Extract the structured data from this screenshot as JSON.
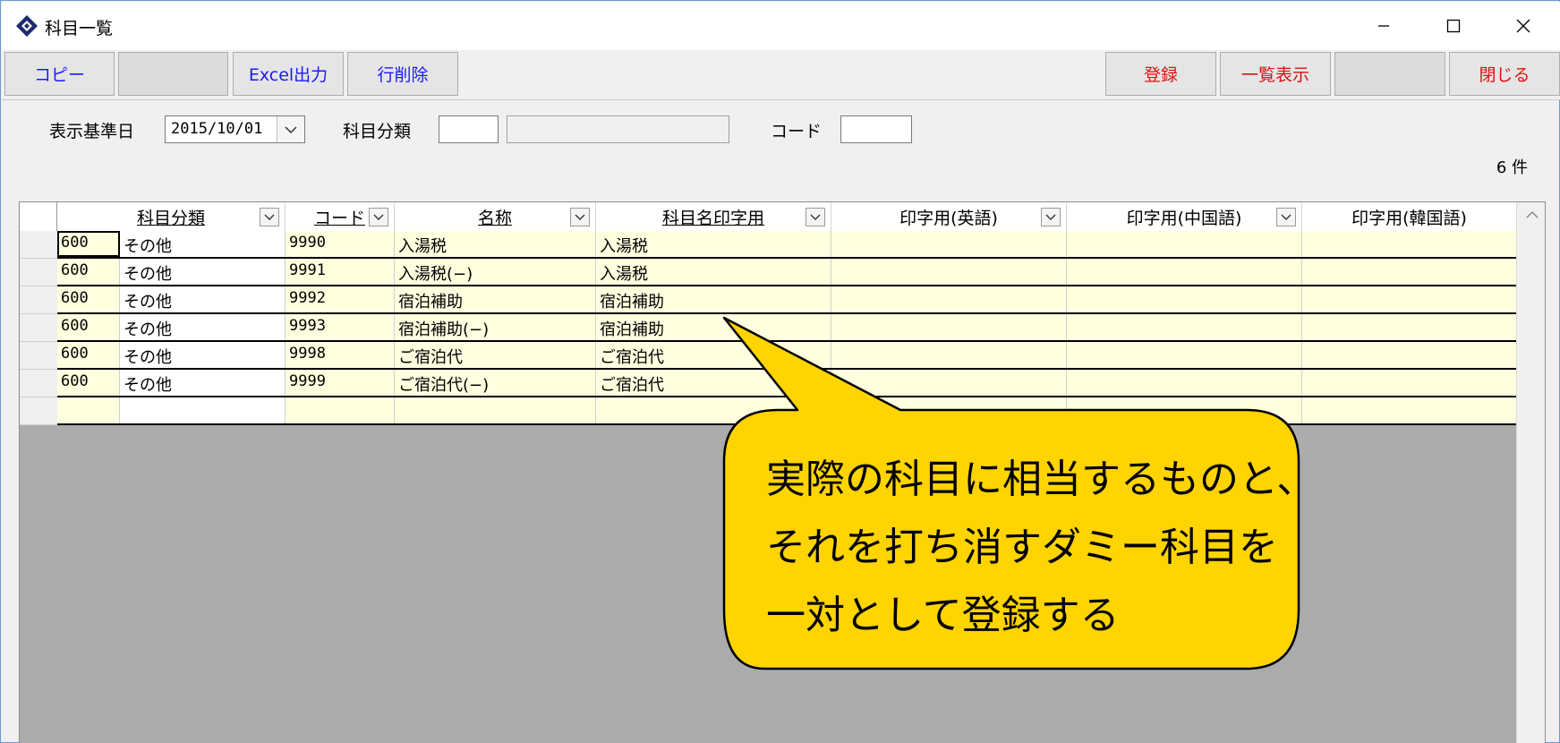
{
  "window": {
    "title": "科目一覧",
    "minimize_icon": "minimize-icon",
    "maximize_icon": "maximize-icon",
    "close_icon": "close-icon"
  },
  "toolbar": {
    "copy_label": "コピー",
    "excel_label": "Excel出力",
    "delete_row_label": "行削除",
    "register_label": "登録",
    "list_label": "一覧表示",
    "close_label": "閉じる"
  },
  "filters": {
    "date_label": "表示基準日",
    "date_value": "2015/10/01",
    "category_label": "科目分類",
    "category_code_value": "",
    "category_name_value": "",
    "code_label": "コード",
    "code_value": ""
  },
  "count_text": "6 件",
  "grid": {
    "headers": [
      "科目分類",
      "コード",
      "名称",
      "科目名印字用",
      "印字用(英語)",
      "印字用(中国語)",
      "印字用(韓国語)"
    ],
    "rows": [
      {
        "cat_code": "600",
        "cat_name": "その他",
        "code": "9990",
        "name": "入湯税",
        "print_name": "入湯税"
      },
      {
        "cat_code": "600",
        "cat_name": "その他",
        "code": "9991",
        "name": "入湯税(−)",
        "print_name": "入湯税"
      },
      {
        "cat_code": "600",
        "cat_name": "その他",
        "code": "9992",
        "name": "宿泊補助",
        "print_name": "宿泊補助"
      },
      {
        "cat_code": "600",
        "cat_name": "その他",
        "code": "9993",
        "name": "宿泊補助(−)",
        "print_name": "宿泊補助"
      },
      {
        "cat_code": "600",
        "cat_name": "その他",
        "code": "9998",
        "name": "ご宿泊代",
        "print_name": "ご宿泊代"
      },
      {
        "cat_code": "600",
        "cat_name": "その他",
        "code": "9999",
        "name": "ご宿泊代(−)",
        "print_name": "ご宿泊代"
      }
    ]
  },
  "callout": {
    "line1": "実際の科目に相当するものと、",
    "line2": "それを打ち消すダミー科目を",
    "line3": "一対として登録する"
  },
  "colors": {
    "callout_fill": "#ffd400",
    "row_highlight": "#ffffe0",
    "button_blue": "#1a1aff",
    "button_red": "#e01010"
  }
}
